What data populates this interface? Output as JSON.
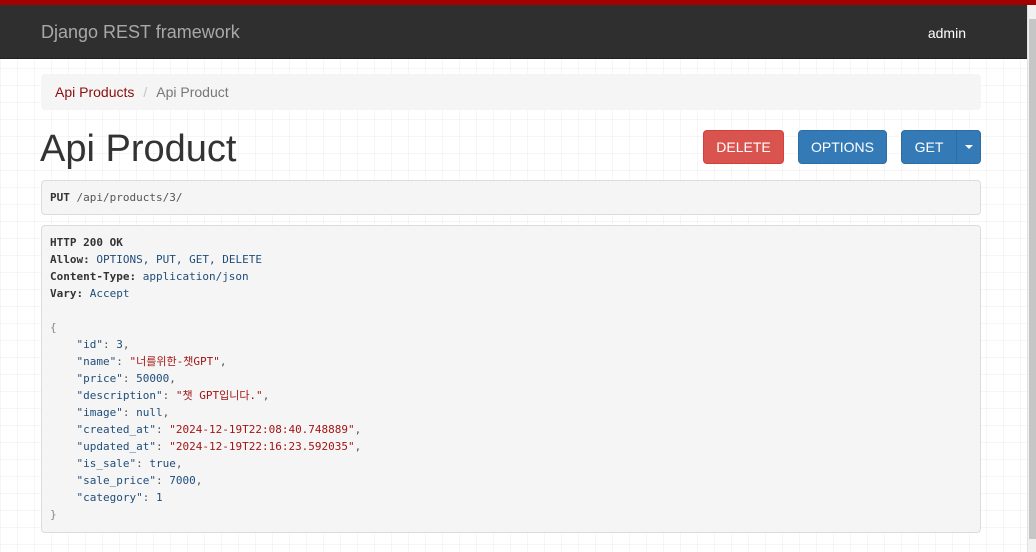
{
  "navbar": {
    "brand": "Django REST framework",
    "user": "admin"
  },
  "breadcrumb": {
    "items": [
      {
        "label": "Api Products"
      },
      {
        "label": "Api Product"
      }
    ],
    "separator": "/"
  },
  "page": {
    "title": "Api Product"
  },
  "toolbar": {
    "delete_label": "DELETE",
    "options_label": "OPTIONS",
    "get_label": "GET"
  },
  "request": {
    "method": "PUT",
    "path": "/api/products/3/"
  },
  "response": {
    "status": "HTTP 200 OK",
    "headers": [
      {
        "key": "Allow:",
        "value": "OPTIONS, PUT, GET, DELETE"
      },
      {
        "key": "Content-Type:",
        "value": "application/json"
      },
      {
        "key": "Vary:",
        "value": "Accept"
      }
    ],
    "body": {
      "open": "{",
      "close": "}",
      "fields": [
        {
          "key": "\"id\"",
          "value": "3",
          "type": "num",
          "comma": true
        },
        {
          "key": "\"name\"",
          "value": "\"너를위한-챗GPT\"",
          "type": "str",
          "comma": true
        },
        {
          "key": "\"price\"",
          "value": "50000",
          "type": "num",
          "comma": true
        },
        {
          "key": "\"description\"",
          "value": "\"챗 GPT입니다.\"",
          "type": "str",
          "comma": true
        },
        {
          "key": "\"image\"",
          "value": "null",
          "type": "lit",
          "comma": true
        },
        {
          "key": "\"created_at\"",
          "value": "\"2024-12-19T22:08:40.748889\"",
          "type": "str",
          "comma": true
        },
        {
          "key": "\"updated_at\"",
          "value": "\"2024-12-19T22:16:23.592035\"",
          "type": "str",
          "comma": true
        },
        {
          "key": "\"is_sale\"",
          "value": "true",
          "type": "lit",
          "comma": true
        },
        {
          "key": "\"sale_price\"",
          "value": "7000",
          "type": "num",
          "comma": true
        },
        {
          "key": "\"category\"",
          "value": "1",
          "type": "num",
          "comma": false
        }
      ]
    }
  },
  "colors": {
    "accent": "#a30000",
    "navbar": "#2f2f2f",
    "danger": "#d9534f",
    "primary": "#337ab7",
    "link": "#8a0e0e"
  }
}
